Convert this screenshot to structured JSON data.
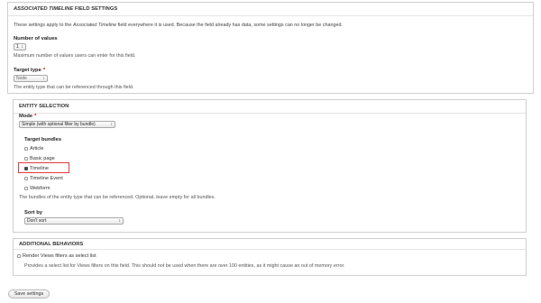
{
  "field_settings": {
    "legend_prefix": "ASSOCIATED TIMELINE",
    "legend_suffix": "FIELD SETTINGS",
    "intro_before": "These settings apply to the ",
    "intro_field": "Associated Timeline",
    "intro_after": " field everywhere it is used. Because the field already has data, some settings can no longer be changed.",
    "number_of_values": {
      "label": "Number of values",
      "selected": "1",
      "description": "Maximum number of values users can enter for this field."
    },
    "target_type": {
      "label": "Target type",
      "required_marker": "*",
      "selected": "Node",
      "description": "The entity type that can be referenced through this field."
    }
  },
  "entity_selection": {
    "legend": "ENTITY SELECTION",
    "mode": {
      "label": "Mode",
      "required_marker": "*",
      "selected": "Simple (with optional filter by bundle)"
    },
    "target_bundles": {
      "label": "Target bundles",
      "items": [
        {
          "label": "Article",
          "checked": false
        },
        {
          "label": "Basic page",
          "checked": false
        },
        {
          "label": "Timeline",
          "checked": true
        },
        {
          "label": "Timeline Event",
          "checked": false
        },
        {
          "label": "Webform",
          "checked": false
        }
      ],
      "description": "The bundles of the entity type that can be referenced. Optional, leave empty for all bundles."
    },
    "sort_by": {
      "label": "Sort by",
      "selected": "Don't sort"
    }
  },
  "additional_behaviors": {
    "legend": "ADDITIONAL BEHAVIORS",
    "render_views": {
      "label": "Render Views filters as select list",
      "checked": false,
      "description": "Provides a select list for Views filters on this field. This should not be used when there are over 100 entities, as it might cause an out of memory error."
    }
  },
  "actions": {
    "save_label": "Save settings"
  },
  "colors": {
    "highlight": "#e03b3b",
    "required": "#cc0000"
  },
  "icons": {
    "select_arrow": "chevron-updown-icon",
    "checkbox": "checkbox-icon"
  }
}
